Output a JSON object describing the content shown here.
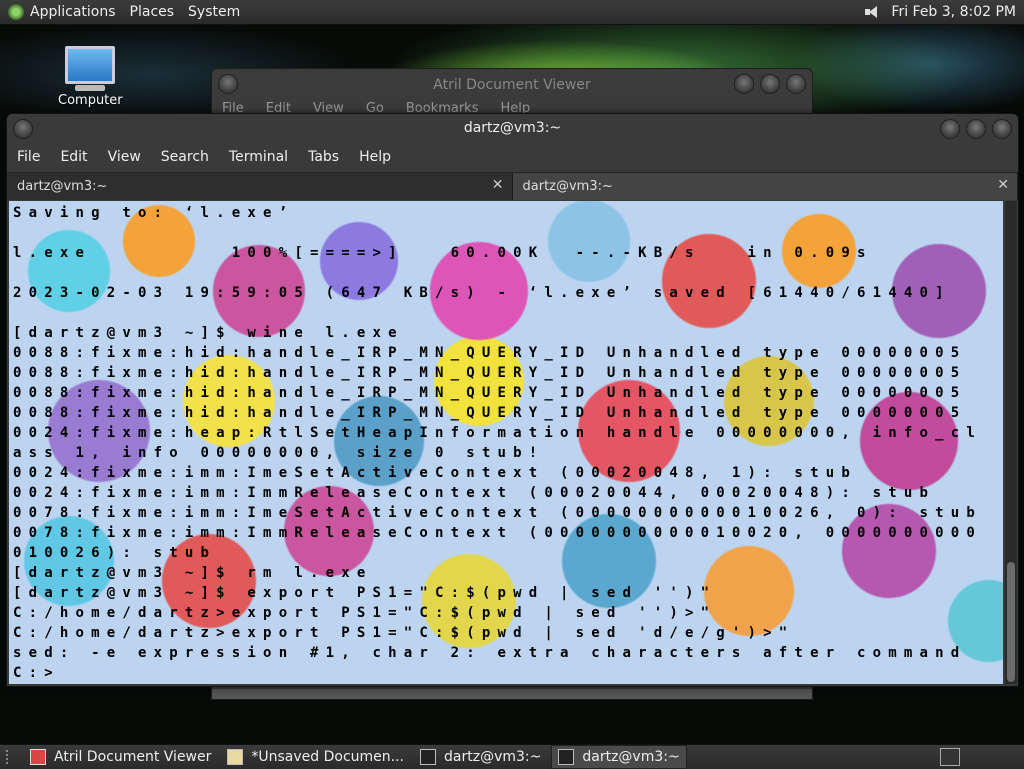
{
  "top_panel": {
    "menus": [
      "Applications",
      "Places",
      "System"
    ],
    "clock": "Fri Feb  3,  8:02 PM"
  },
  "desktop": {
    "icons": [
      {
        "label": "Computer",
        "icon": "computer-icon"
      }
    ]
  },
  "atril_window": {
    "title": "Atril Document Viewer",
    "menus": [
      "File",
      "Edit",
      "View",
      "Go",
      "Bookmarks",
      "Help"
    ]
  },
  "terminal_window": {
    "title": "dartz@vm3:~",
    "menus": [
      "File",
      "Edit",
      "View",
      "Search",
      "Terminal",
      "Tabs",
      "Help"
    ],
    "tabs": [
      {
        "label": "dartz@vm3:~",
        "close": "✕"
      },
      {
        "label": "dartz@vm3:~",
        "close": "✕"
      }
    ],
    "lines": [
      "Saving to: ‘l.exe’",
      "",
      "l.exe         100%[====>]   60.00K  --.-KB/s   in 0.09s",
      "",
      "2023-02-03 19:59:05 (647 KB/s) - ‘l.exe’ saved [61440/61440]",
      "",
      "[dartz@vm3 ~]$ wine l.exe",
      "0088:fixme:hid:handle_IRP_MN_QUERY_ID Unhandled type 00000005",
      "0088:fixme:hid:handle_IRP_MN_QUERY_ID Unhandled type 00000005",
      "0088:fixme:hid:handle_IRP_MN_QUERY_ID Unhandled type 00000005",
      "0088:fixme:hid:handle_IRP_MN_QUERY_ID Unhandled type 00000005",
      "0024:fixme:heap:RtlSetHeapInformation handle 00000000, info_cl",
      "ass 1, info 00000000, size 0 stub!",
      "0024:fixme:imm:ImeSetActiveContext (00020048, 1): stub",
      "0024:fixme:imm:ImmReleaseContext (00020044, 00020048): stub",
      "0078:fixme:imm:ImeSetActiveContext (0000000000010026, 0): stub",
      "0078:fixme:imm:ImmReleaseContext (0000000000010020, 0000000000",
      "010026): stub",
      "[dartz@vm3 ~]$ rm l.exe",
      "[dartz@vm3 ~]$ export PS1=\"C:$(pwd | sed '')\"",
      "C:/home/dartz>export PS1=\"C:$(pwd | sed '')>\"",
      "C:/home/dartz>export PS1=\"C:$(pwd | sed 'd/e/g')>\"",
      "sed: -e expression #1, char 2: extra characters after command",
      "C:>"
    ]
  },
  "taskbar": {
    "tasks": [
      {
        "label": "Atril Document Viewer",
        "icon": "document-viewer-icon",
        "active": false
      },
      {
        "label": "*Unsaved Documen...",
        "icon": "text-editor-icon",
        "active": false
      },
      {
        "label": "dartz@vm3:~",
        "icon": "terminal-icon",
        "active": false
      },
      {
        "label": "dartz@vm3:~",
        "icon": "terminal-icon",
        "active": true
      }
    ]
  }
}
